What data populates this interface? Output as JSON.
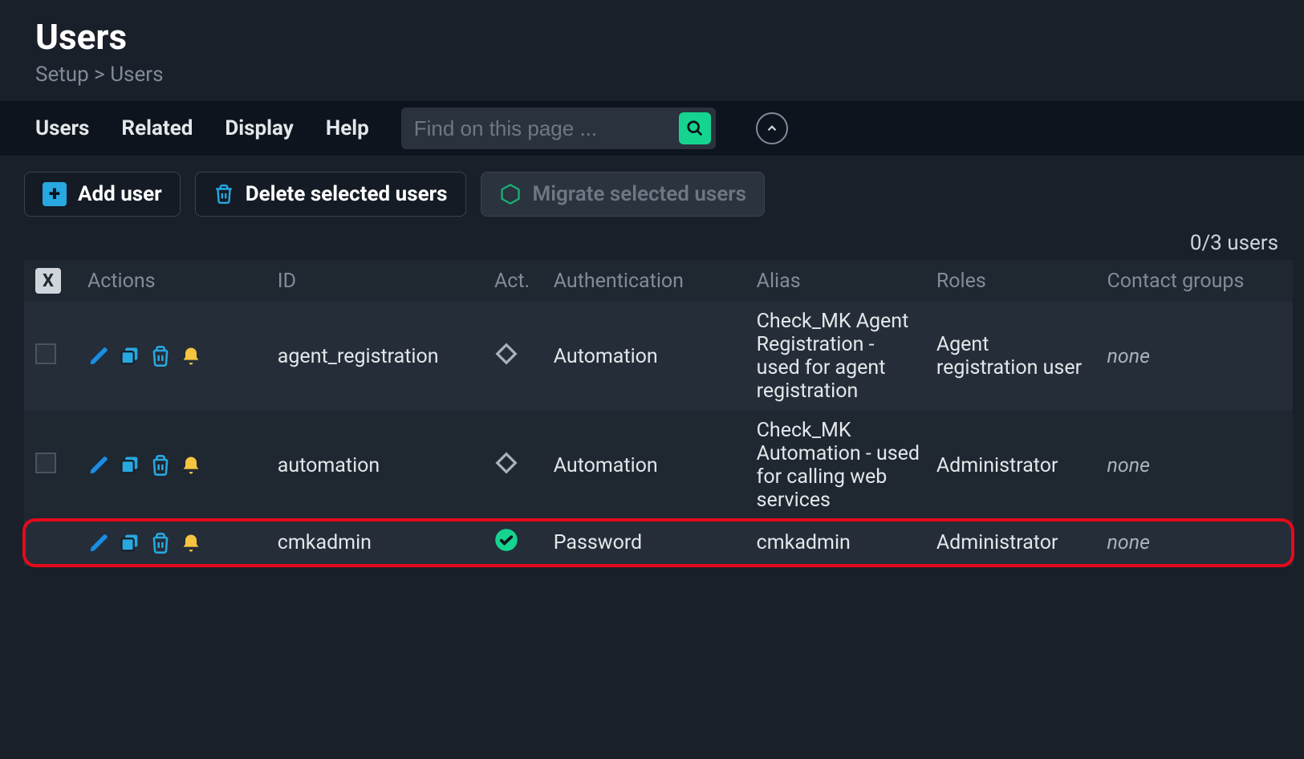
{
  "header": {
    "title": "Users",
    "breadcrumb_setup": "Setup",
    "breadcrumb_sep": ">",
    "breadcrumb_users": "Users"
  },
  "menubar": {
    "users": "Users",
    "related": "Related",
    "display": "Display",
    "help": "Help"
  },
  "search": {
    "placeholder": "Find on this page ..."
  },
  "toolbar": {
    "add_user": "Add user",
    "delete_selected": "Delete selected users",
    "migrate_selected": "Migrate selected users"
  },
  "count_label": "0/3 users",
  "columns": {
    "select_toggle": "X",
    "actions": "Actions",
    "id": "ID",
    "act": "Act.",
    "auth": "Authentication",
    "alias": "Alias",
    "roles": "Roles",
    "contact_groups": "Contact groups"
  },
  "rows": [
    {
      "selectable": true,
      "id": "agent_registration",
      "act_state": "diamond",
      "auth": "Automation",
      "alias": "Check_MK Agent Registration - used for agent registration",
      "roles": "Agent registration user",
      "contact_groups": "none",
      "highlight": false
    },
    {
      "selectable": true,
      "id": "automation",
      "act_state": "diamond",
      "auth": "Automation",
      "alias": "Check_MK Automation - used for calling web services",
      "roles": "Administrator",
      "contact_groups": "none",
      "highlight": false
    },
    {
      "selectable": false,
      "id": "cmkadmin",
      "act_state": "check",
      "auth": "Password",
      "alias": "cmkadmin",
      "roles": "Administrator",
      "contact_groups": "none",
      "highlight": true
    }
  ]
}
